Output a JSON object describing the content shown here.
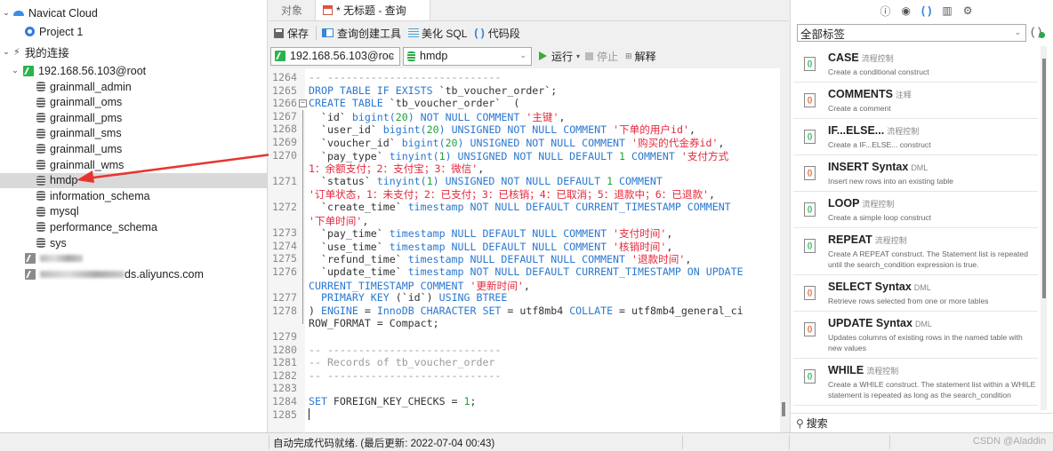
{
  "nav": {
    "cloud_label": "Navicat Cloud",
    "project_label": "Project 1",
    "my_connections_label": "我的连接",
    "connection_label": "192.168.56.103@root",
    "databases": [
      "grainmall_admin",
      "grainmall_oms",
      "grainmall_pms",
      "grainmall_sms",
      "grainmall_ums",
      "grainmall_wms",
      "hmdp",
      "information_schema",
      "mysql",
      "performance_schema",
      "sys"
    ],
    "selected_database": "hmdp",
    "other_connection_2_suffix": "ds.aliyuncs.com"
  },
  "tabs": [
    {
      "label": "对象"
    },
    {
      "label": "* 无标题 - 查询"
    }
  ],
  "toolbar": {
    "save_label": "保存",
    "query_builder_label": "查询创建工具",
    "beautify_label": "美化 SQL",
    "snippet_label": "代码段",
    "connection_select": "192.168.56.103@roc",
    "database_select": "hmdp",
    "run_label": "运行",
    "stop_label": "停止",
    "explain_label": "解释"
  },
  "editor": {
    "line_numbers": [
      "1264",
      "1265",
      "1266",
      "1267",
      "1268",
      "1269",
      "1270",
      "",
      "1271",
      "",
      "1272",
      "",
      "1273",
      "1274",
      "1275",
      "1276",
      "",
      "1277",
      "1278",
      "",
      "1279",
      "1280",
      "1281",
      "1282",
      "1283",
      "1284",
      "1285"
    ],
    "lines": [
      [
        [
          "cmt",
          "-- ----------------------------"
        ]
      ],
      [
        [
          "kw",
          "DROP TABLE IF EXISTS "
        ],
        [
          "",
          "`tb_voucher_order`;"
        ]
      ],
      [
        [
          "kw",
          "CREATE TABLE "
        ],
        [
          "",
          "`tb_voucher_order`  ("
        ]
      ],
      [
        [
          "",
          "  `id` "
        ],
        [
          "kw",
          "bigint("
        ],
        [
          "num",
          "20"
        ],
        [
          "kw",
          ") NOT NULL COMMENT "
        ],
        [
          "str",
          "'主键'"
        ],
        [
          "",
          ","
        ]
      ],
      [
        [
          "",
          "  `user_id` "
        ],
        [
          "kw",
          "bigint("
        ],
        [
          "num",
          "20"
        ],
        [
          "kw",
          ") UNSIGNED NOT NULL COMMENT "
        ],
        [
          "str",
          "'下单的用户id'"
        ],
        [
          "",
          ","
        ]
      ],
      [
        [
          "",
          "  `voucher_id` "
        ],
        [
          "kw",
          "bigint("
        ],
        [
          "num",
          "20"
        ],
        [
          "kw",
          ") UNSIGNED NOT NULL COMMENT "
        ],
        [
          "str",
          "'购买的代金券id'"
        ],
        [
          "",
          ","
        ]
      ],
      [
        [
          "",
          "  `pay_type` "
        ],
        [
          "kw",
          "tinyint("
        ],
        [
          "num",
          "1"
        ],
        [
          "kw",
          ") UNSIGNED NOT NULL DEFAULT "
        ],
        [
          "num",
          "1"
        ],
        [
          "kw",
          " COMMENT "
        ],
        [
          "str",
          "'支付方式"
        ]
      ],
      [
        [
          "str",
          "1：余额支付；2：支付宝；3：微信'"
        ],
        [
          "",
          ","
        ]
      ],
      [
        [
          "",
          "  `status` "
        ],
        [
          "kw",
          "tinyint("
        ],
        [
          "num",
          "1"
        ],
        [
          "kw",
          ") UNSIGNED NOT NULL DEFAULT "
        ],
        [
          "num",
          "1"
        ],
        [
          "kw",
          " COMMENT"
        ]
      ],
      [
        [
          "str",
          "'订单状态，1：未支付；2：已支付；3：已核销；4：已取消；5：退款中；6：已退款'"
        ],
        [
          "",
          ","
        ]
      ],
      [
        [
          "",
          "  `create_time` "
        ],
        [
          "kw",
          "timestamp NOT NULL DEFAULT CURRENT_TIMESTAMP COMMENT"
        ]
      ],
      [
        [
          "str",
          "'下单时间'"
        ],
        [
          "",
          ","
        ]
      ],
      [
        [
          "",
          "  `pay_time` "
        ],
        [
          "kw",
          "timestamp NULL DEFAULT NULL COMMENT "
        ],
        [
          "str",
          "'支付时间'"
        ],
        [
          "",
          ","
        ]
      ],
      [
        [
          "",
          "  `use_time` "
        ],
        [
          "kw",
          "timestamp NULL DEFAULT NULL COMMENT "
        ],
        [
          "str",
          "'核销时间'"
        ],
        [
          "",
          ","
        ]
      ],
      [
        [
          "",
          "  `refund_time` "
        ],
        [
          "kw",
          "timestamp NULL DEFAULT NULL COMMENT "
        ],
        [
          "str",
          "'退款时间'"
        ],
        [
          "",
          ","
        ]
      ],
      [
        [
          "",
          "  `update_time` "
        ],
        [
          "kw",
          "timestamp NOT NULL DEFAULT CURRENT_TIMESTAMP ON UPDATE"
        ]
      ],
      [
        [
          "kw",
          "CURRENT_TIMESTAMP COMMENT "
        ],
        [
          "str",
          "'更新时间'"
        ],
        [
          "",
          ","
        ]
      ],
      [
        [
          "kw",
          "  PRIMARY KEY "
        ],
        [
          "",
          "(`id`) "
        ],
        [
          "kw",
          "USING BTREE"
        ]
      ],
      [
        [
          "",
          ") "
        ],
        [
          "kw",
          "ENGINE"
        ],
        [
          "",
          " = "
        ],
        [
          "kw",
          "InnoDB CHARACTER SET"
        ],
        [
          "",
          " = utf8mb4 "
        ],
        [
          "kw",
          "COLLATE"
        ],
        [
          "",
          " = utf8mb4_general_ci"
        ]
      ],
      [
        [
          "",
          "ROW_FORMAT = Compact;"
        ]
      ],
      [
        [
          "",
          ""
        ]
      ],
      [
        [
          "cmt",
          "-- ----------------------------"
        ]
      ],
      [
        [
          "cmt",
          "-- Records of tb_voucher_order"
        ]
      ],
      [
        [
          "cmt",
          "-- ----------------------------"
        ]
      ],
      [
        [
          "",
          ""
        ]
      ],
      [
        [
          "kw",
          "SET "
        ],
        [
          "",
          "FOREIGN_KEY_CHECKS = "
        ],
        [
          "num",
          "1"
        ],
        [
          "",
          ";"
        ]
      ],
      [
        [
          "",
          ""
        ]
      ]
    ]
  },
  "right_panel": {
    "tag_filter": "全部标签",
    "snippets": [
      {
        "title": "CASE",
        "tag": "流程控制",
        "desc": "Create a conditional construct",
        "icon": "g"
      },
      {
        "title": "COMMENTS",
        "tag": "注释",
        "desc": "Create a comment",
        "icon": "c"
      },
      {
        "title": "IF...ELSE...",
        "tag": "流程控制",
        "desc": "Create a IF...ELSE... construct",
        "icon": "g"
      },
      {
        "title": "INSERT Syntax",
        "tag": "DML",
        "desc": "Insert new rows into an existing table",
        "icon": "c"
      },
      {
        "title": "LOOP",
        "tag": "流程控制",
        "desc": "Create a simple loop construct",
        "icon": "g"
      },
      {
        "title": "REPEAT",
        "tag": "流程控制",
        "desc": "Create A REPEAT construct. The Statement list is repeated until the search_condition expression is true.",
        "icon": "g"
      },
      {
        "title": "SELECT Syntax",
        "tag": "DML",
        "desc": "Retrieve rows selected from one or more tables",
        "icon": "c"
      },
      {
        "title": "UPDATE Syntax",
        "tag": "DML",
        "desc": "Updates columns of existing rows in the named table with new values",
        "icon": "c"
      },
      {
        "title": "WHILE",
        "tag": "流程控制",
        "desc": "Create a WHILE construct. The statement list within a WHILE statement is repeated as long as the search_condition",
        "icon": "g"
      }
    ],
    "search_label": "搜索"
  },
  "status": {
    "text": "自动完成代码就绪. (最后更新: 2022-07-04 00:43)",
    "watermark": "CSDN @Aladdin"
  }
}
